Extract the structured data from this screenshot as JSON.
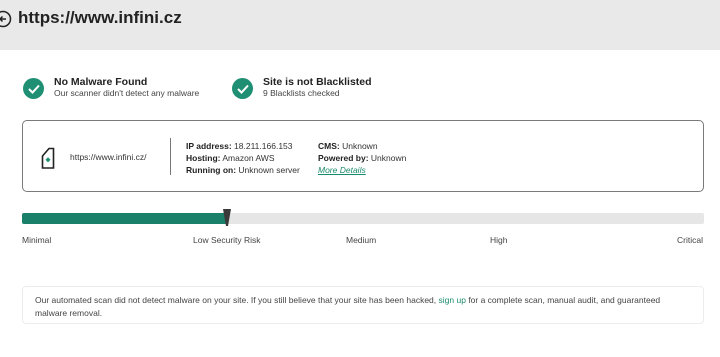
{
  "header": {
    "title": "https://www.infini.cz"
  },
  "checks": [
    {
      "title": "No Malware Found",
      "subtitle": "Our scanner didn't detect any malware"
    },
    {
      "title": "Site is not Blacklisted",
      "subtitle": "9 Blacklists checked"
    }
  ],
  "site_info": {
    "url": "https://www.infini.cz/",
    "ip_label": "IP address:",
    "ip_value": "18.211.166.153",
    "hosting_label": "Hosting:",
    "hosting_value": "Amazon AWS",
    "running_label": "Running on:",
    "running_value": "Unknown server",
    "cms_label": "CMS:",
    "cms_value": "Unknown",
    "powered_label": "Powered by:",
    "powered_value": "Unknown",
    "more_details": "More Details"
  },
  "risk": {
    "level_fraction": 0.3,
    "labels": [
      "Minimal",
      "Low Security Risk",
      "Medium",
      "High",
      "Critical"
    ],
    "accent_color": "#1b806a"
  },
  "notice": {
    "text_before": "Our automated scan did not detect malware on your site. If you still believe that your site has been hacked,",
    "link": "sign up",
    "text_after": "for a complete scan, manual audit, and guaranteed malware removal."
  }
}
